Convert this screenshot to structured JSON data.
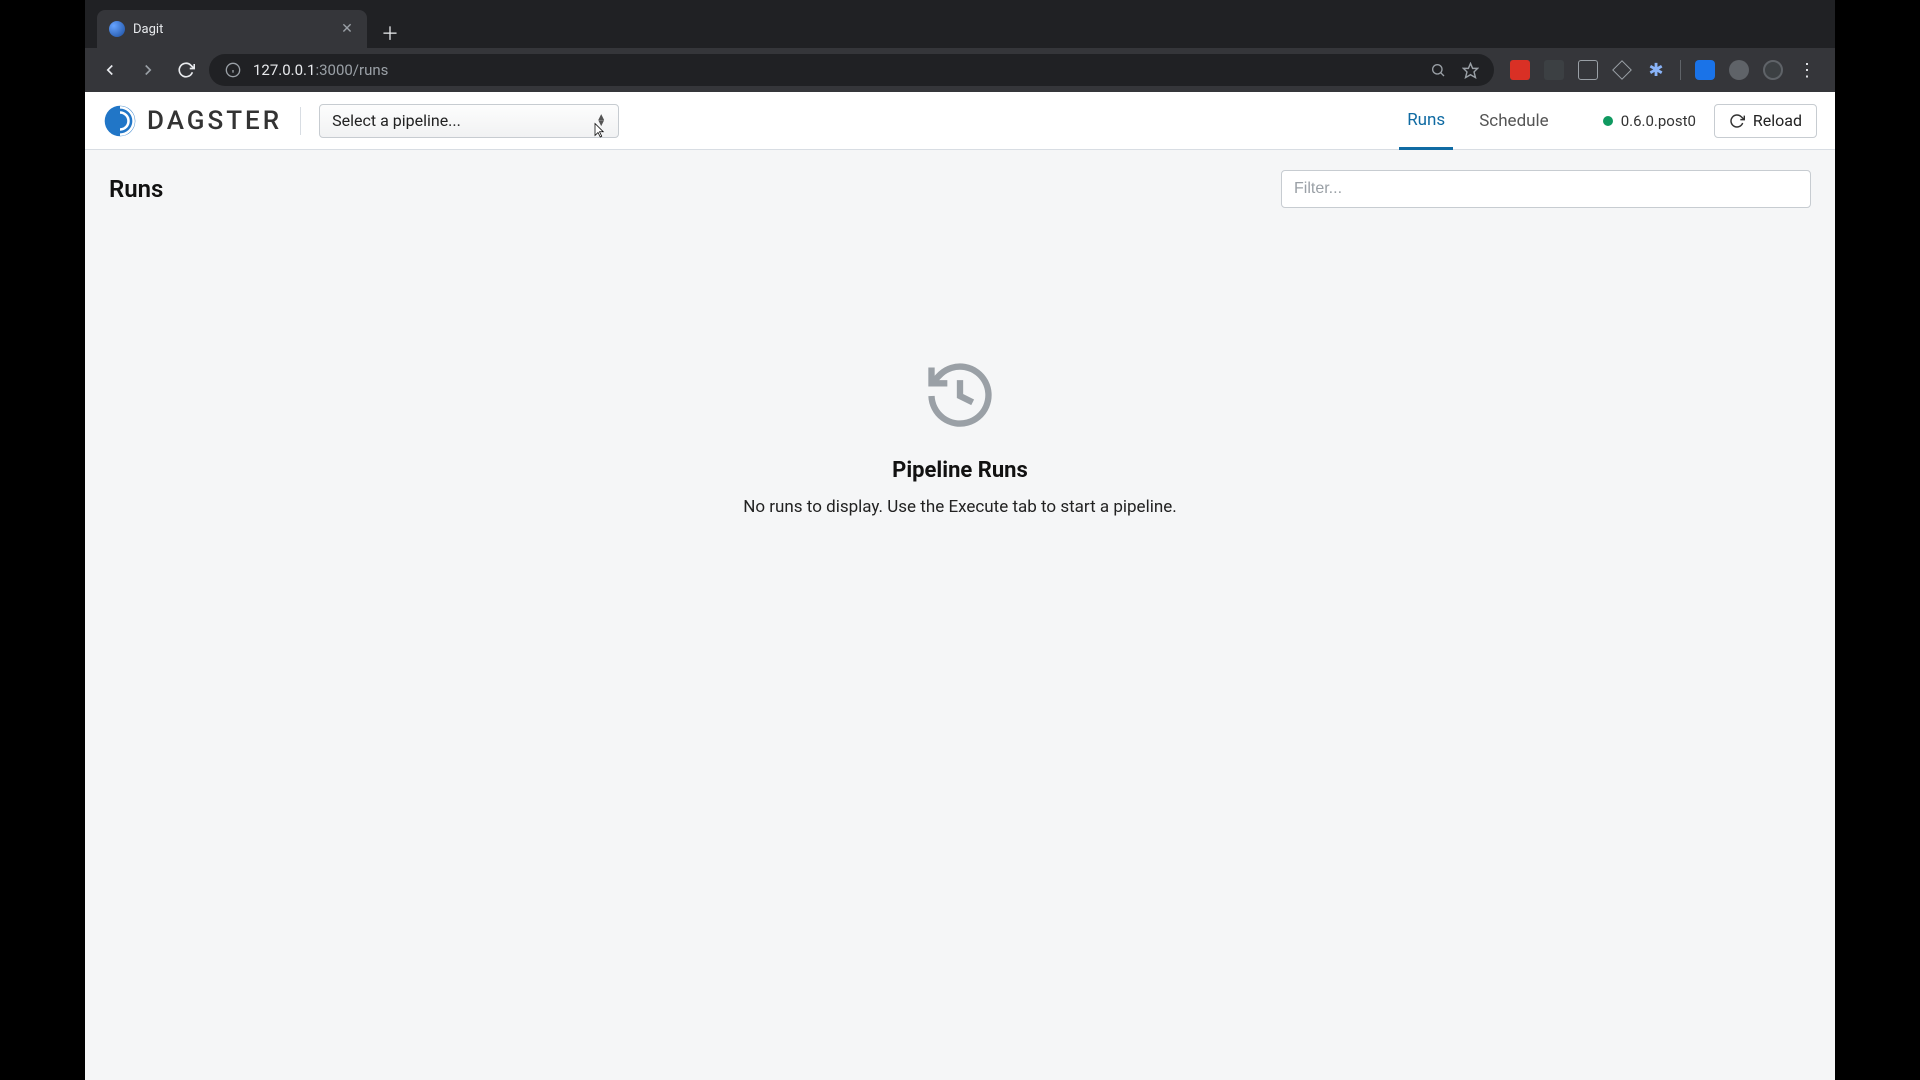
{
  "browser": {
    "tab_title": "Dagit",
    "url_host": "127.0.0.1",
    "url_path": ":3000/runs"
  },
  "header": {
    "logo_text": "DAGSTER",
    "pipeline_select_placeholder": "Select a pipeline...",
    "nav": {
      "runs": "Runs",
      "schedule": "Schedule"
    },
    "version": "0.6.0.post0",
    "reload_label": "Reload"
  },
  "page": {
    "title": "Runs",
    "filter_placeholder": "Filter..."
  },
  "empty": {
    "title": "Pipeline Runs",
    "description": "No runs to display. Use the Execute tab to start a pipeline."
  }
}
